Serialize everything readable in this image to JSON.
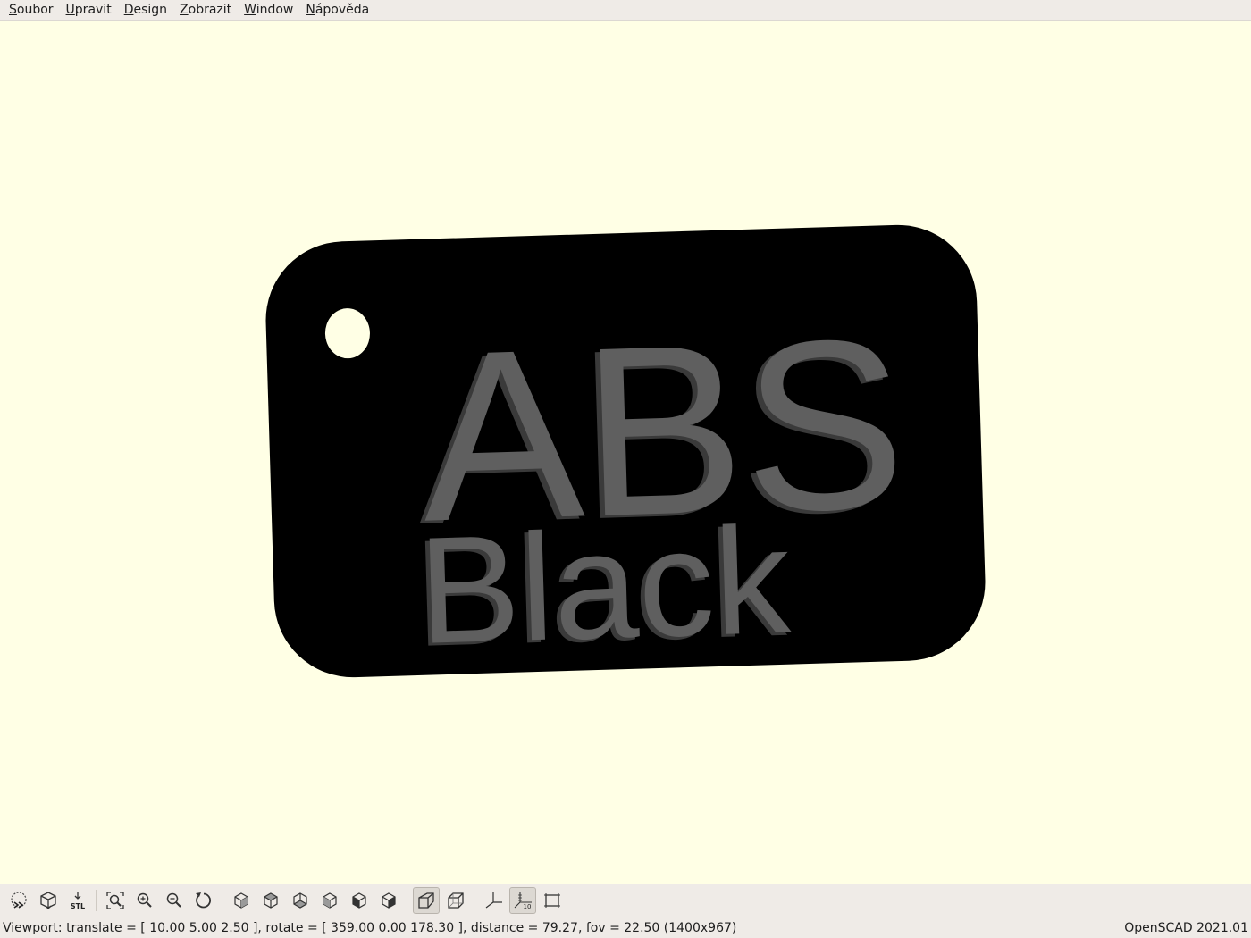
{
  "menu": [
    {
      "underline": "S",
      "rest": "oubor"
    },
    {
      "underline": "U",
      "rest": "pravit"
    },
    {
      "underline": "D",
      "rest": "esign"
    },
    {
      "underline": "Z",
      "rest": "obrazit"
    },
    {
      "underline": "W",
      "rest": "indow"
    },
    {
      "underline": "N",
      "rest": "ápověda"
    }
  ],
  "model": {
    "line1": "ABS",
    "line2": "Black",
    "plate_color": "#000000",
    "text_color": "#5f5f5f",
    "background_color": "#ffffe5"
  },
  "toolbar": {
    "icons": [
      "preview-icon",
      "render-icon",
      "export-stl-icon",
      "view-all-icon",
      "zoom-in-icon",
      "zoom-out-icon",
      "reset-view-icon",
      "view-right-icon",
      "view-top-icon",
      "view-bottom-icon",
      "view-left-icon",
      "view-front-icon",
      "view-back-icon",
      "perspective-icon",
      "orthogonal-icon",
      "show-axes-icon",
      "show-scale-markers-icon",
      "show-edges-icon"
    ],
    "stl_label": "STL",
    "scale_label": "10"
  },
  "status": {
    "viewport": "Viewport: translate = [ 10.00 5.00 2.50 ], rotate = [ 359.00 0.00 178.30 ], distance = 79.27, fov = 22.50 (1400x967)",
    "version": "OpenSCAD 2021.01"
  }
}
